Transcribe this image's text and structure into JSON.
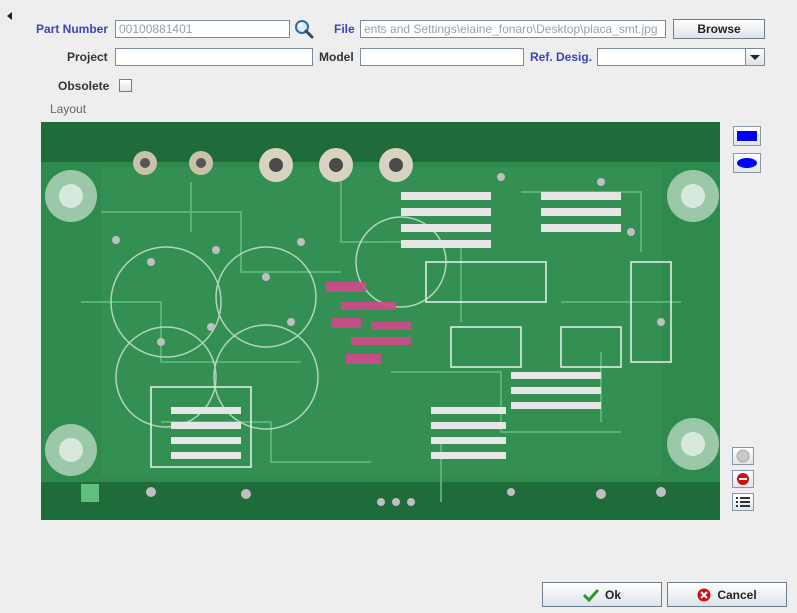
{
  "form": {
    "part_number_label": "Part Number",
    "part_number_value": "00100881401",
    "file_label": "File",
    "file_value": "ents and Settings\\elaine_fonaro\\Desktop\\placa_smt.jpg",
    "browse_label": "Browse",
    "project_label": "Project",
    "project_value": "",
    "model_label": "Model",
    "model_value": "",
    "ref_desig_label": "Ref. Desig.",
    "ref_desig_value": "",
    "obsolete_label": "Obsolete",
    "obsolete_checked": false
  },
  "layout": {
    "label": "Layout",
    "image_subject": "green printed circuit board"
  },
  "tools": {
    "rectangle_icon": "rectangle-shape-icon",
    "ellipse_icon": "ellipse-shape-icon",
    "disabled_icon": "gray-circle-icon",
    "remove_icon": "remove-icon",
    "list_icon": "list-icon"
  },
  "footer": {
    "ok_label": "Ok",
    "cancel_label": "Cancel"
  },
  "colors": {
    "link_label": "#3a46b5",
    "shape_fill": "#0000ff",
    "pcb_green": "#2f8a4e",
    "remove_red": "#cc1111",
    "ok_green": "#2a9a2a"
  }
}
